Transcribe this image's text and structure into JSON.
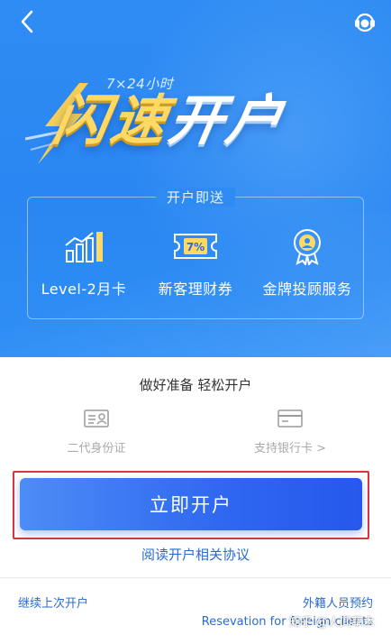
{
  "hero": {
    "slogan_sub": "7×24小时",
    "slogan_gold": "闪速",
    "slogan_white": "开户",
    "gift_title": "开户即送",
    "gifts": [
      {
        "label": "Level-2月卡",
        "icon": "bar-chart-icon"
      },
      {
        "label": "新客理财券",
        "icon": "coupon-icon",
        "badge": "7%"
      },
      {
        "label": "金牌投顾服务",
        "icon": "medal-icon"
      }
    ]
  },
  "lower": {
    "ready": "做好准备 轻松开户",
    "id_label": "二代身份证",
    "card_label": "支持银行卡",
    "card_chevron": ">",
    "cta_label": "立即开户",
    "agreement": "阅读开户相关协议",
    "continue": "继续上次开户",
    "foreign": "外籍人员预约",
    "foreign_en": "Resevation for foreign clients"
  },
  "watermark": "知乎 @人间草木",
  "colors": {
    "hero_blue": "#2f8cf3",
    "gold": "#ffd966",
    "link_blue": "#2a6bd1",
    "cta_blue": "#2f67f0",
    "highlight_red": "#d9363e"
  }
}
